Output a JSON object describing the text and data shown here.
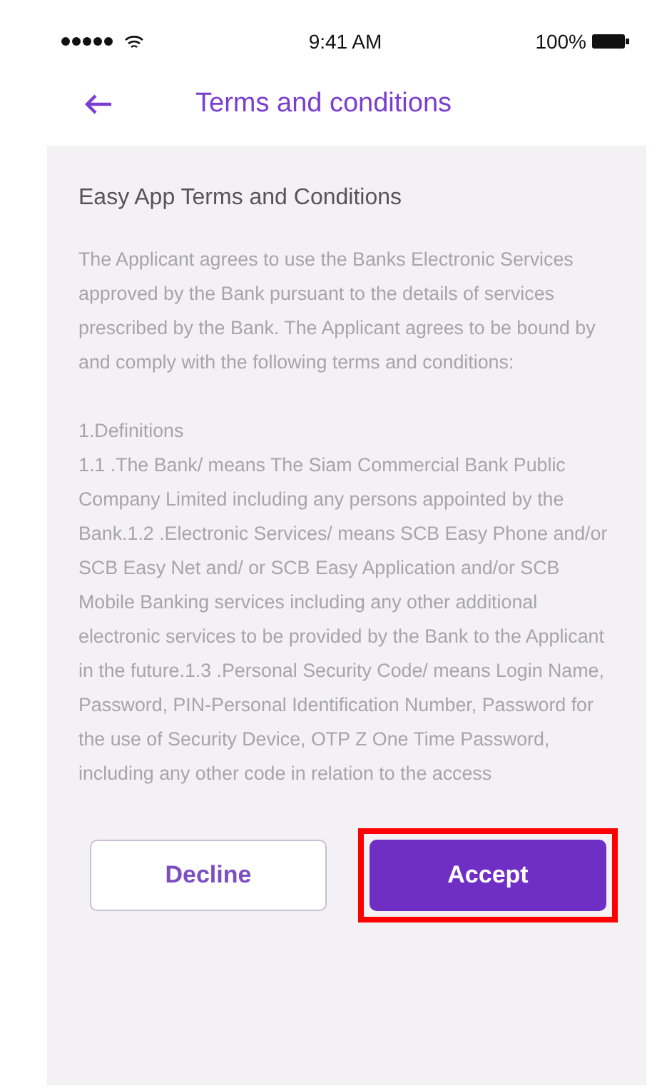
{
  "status_bar": {
    "time": "9:41 AM",
    "battery": "100%"
  },
  "header": {
    "title": "Terms and conditions"
  },
  "content": {
    "title": "Easy App Terms and Conditions",
    "paragraphs": [
      "The Applicant agrees to use the Banks Electronic Services approved by the Bank pursuant to the details of services prescribed by the Bank. The Applicant agrees to be bound by and comply with the following terms and conditions:"
    ],
    "section_heading": "1.Definitions",
    "section_text": "1.1 .The Bank/ means The Siam Commercial Bank Public Company Limited including any persons appointed by the Bank.1.2 .Electronic Services/ means SCB Easy Phone and/or SCB Easy Net and/ or SCB Easy Application and/or SCB Mobile Banking services including any other additional electronic services to be provided by the Bank to the Applicant in the future.1.3 .Personal Security Code/ means Login Name, Password, PIN-Personal Identification Number, Password for the use of Security Device, OTP Z One Time Password, including any other code in relation to the access"
  },
  "buttons": [
    {
      "label": "Decline",
      "kind": "outline",
      "highlighted": false
    },
    {
      "label": "Accept",
      "kind": "filled",
      "highlighted": true
    }
  ]
}
